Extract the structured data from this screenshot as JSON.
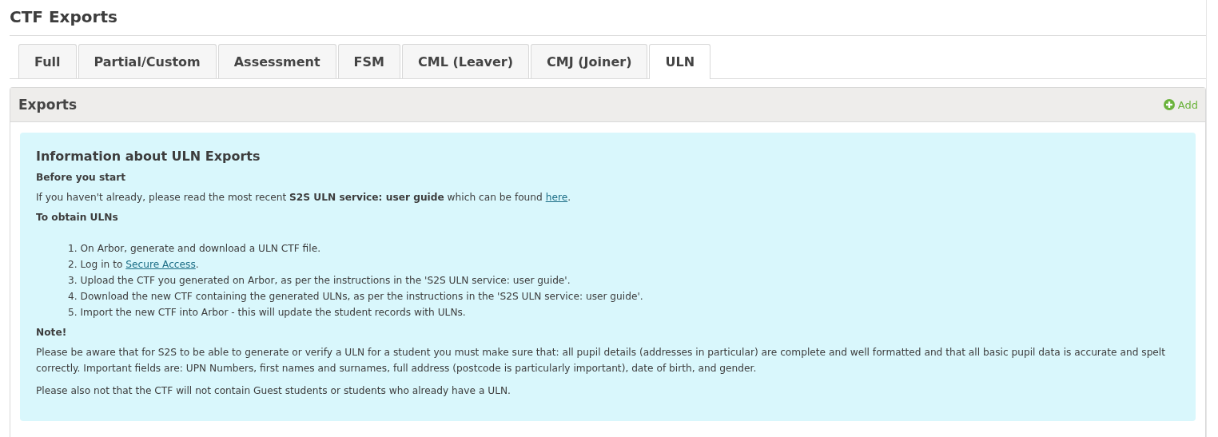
{
  "page": {
    "title": "CTF Exports"
  },
  "tabs": [
    {
      "label": "Full",
      "selected": false
    },
    {
      "label": "Partial/Custom",
      "selected": false
    },
    {
      "label": "Assessment",
      "selected": false
    },
    {
      "label": "FSM",
      "selected": false
    },
    {
      "label": "CML (Leaver)",
      "selected": false
    },
    {
      "label": "CMJ (Joiner)",
      "selected": false
    },
    {
      "label": "ULN",
      "selected": true
    }
  ],
  "panel": {
    "title": "Exports",
    "add_label": "Add"
  },
  "info": {
    "title": "Information about ULN Exports",
    "before_heading": "Before you start",
    "intro": {
      "text": "If you haven't already, please read the most recent **S2S ULN service: user guide** which can be found ",
      "link": "here",
      "after": "."
    },
    "steps_heading": "To obtain ULNs",
    "steps": [
      {
        "number": "1.",
        "text": "On Arbor, generate and download a ULN CTF file."
      },
      {
        "number": "2.",
        "text": "Log in to ",
        "link": "Secure Access",
        "after": "."
      },
      {
        "number": "3.",
        "text": "Upload the CTF you generated on Arbor, as per the instructions in the 'S2S ULN service: user guide'."
      },
      {
        "number": "4.",
        "text": "Download the new CTF containing the generated ULNs, as per the instructions in the 'S2S ULN service: user guide'."
      },
      {
        "number": "5.",
        "text": "Import the new CTF into Arbor - this will update the student records with ULNs."
      }
    ],
    "note_heading": "Note!",
    "note_paragraphs": [
      "Please be aware that for S2S to be able to generate or verify a ULN for a student you must make sure that: all pupil details (addresses in particular) are complete and well formatted and that all basic pupil data is accurate and spelt correctly. Important fields are: UPN Numbers, first names and surnames, full address (postcode is particularly important), date of birth, and gender.",
      "Please also not that the CTF will not contain Guest students or students who already have a ULN."
    ]
  }
}
